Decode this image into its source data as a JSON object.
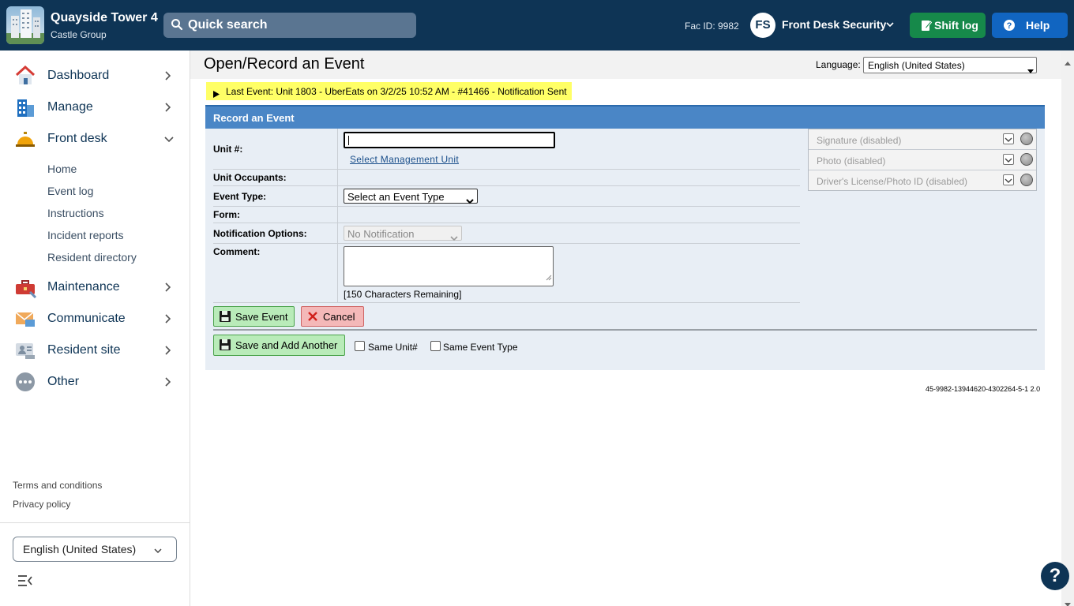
{
  "header": {
    "property_name": "Quayside Tower 4",
    "company": "Castle Group",
    "search_label": "Quick search",
    "fac_id": "Fac ID: 9982",
    "avatar_initials": "FS",
    "user_name": "Front Desk Security",
    "shift_log_label": "Shift log",
    "help_label": "Help",
    "colors": {
      "bar": "#0e3455",
      "shift_log": "#16894a",
      "help": "#1165c1"
    }
  },
  "sidebar": {
    "items": [
      {
        "label": "Dashboard",
        "icon": "house-icon"
      },
      {
        "label": "Manage",
        "icon": "building-icon"
      },
      {
        "label": "Front desk",
        "icon": "service-bell-icon",
        "expanded": true
      },
      {
        "label": "Maintenance",
        "icon": "toolbox-icon"
      },
      {
        "label": "Communicate",
        "icon": "envelope-icon"
      },
      {
        "label": "Resident site",
        "icon": "id-card-icon"
      },
      {
        "label": "Other",
        "icon": "more-icon"
      }
    ],
    "front_desk_sub": [
      "Home",
      "Event log",
      "Instructions",
      "Incident reports",
      "Resident directory"
    ],
    "terms": "Terms and conditions",
    "privacy": "Privacy policy",
    "language": "English (United States)"
  },
  "main": {
    "title": "Open/Record an Event",
    "language_label": "Language:",
    "language_value": "English (United States)",
    "last_event": "Last Event: Unit 1803 - UberEats on 3/2/25 10:52 AM - #41466 - Notification Sent",
    "form_title": "Record an Event",
    "labels": {
      "unit": "Unit #:",
      "occupants": "Unit Occupants:",
      "event_type": "Event Type:",
      "form": "Form:",
      "notification": "Notification Options:",
      "comment": "Comment:"
    },
    "select_mgmt_unit": "Select Management Unit",
    "event_type_placeholder": "Select an Event Type",
    "notification_value": "No Notification",
    "chars_remaining": "[150 Characters Remaining]",
    "captures": [
      "Signature (disabled)",
      "Photo (disabled)",
      "Driver's License/Photo ID (disabled)"
    ],
    "save_event": "Save Event",
    "cancel": "Cancel",
    "save_add_another": "Save and Add Another",
    "same_unit": "Same Unit#",
    "same_event_type": "Same Event Type",
    "version": "45-9982-13944620-4302264-5-1 2.0"
  },
  "help_fab": "?"
}
